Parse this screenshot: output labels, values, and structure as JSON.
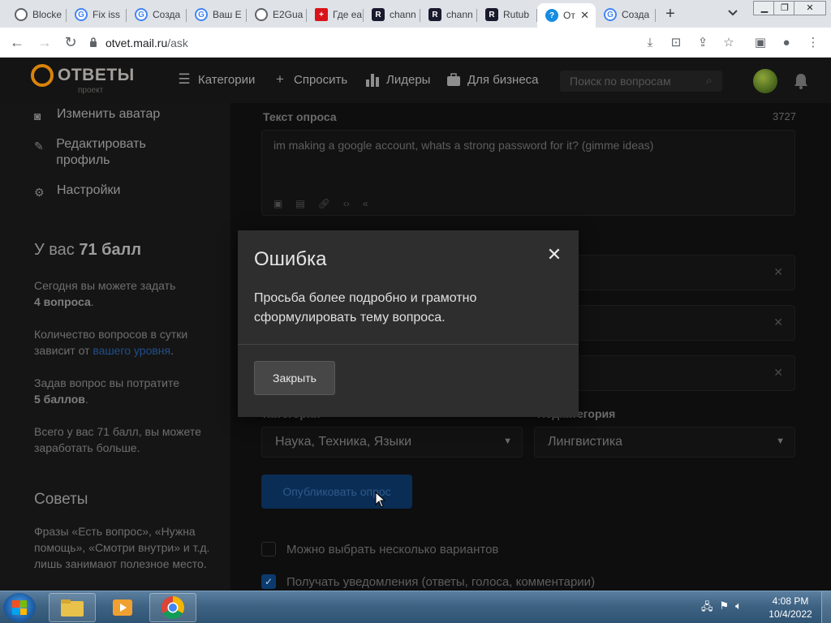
{
  "browser": {
    "tabs": [
      {
        "title": "Blocke",
        "fav": "globe",
        "color": "#5f6368"
      },
      {
        "title": "Fix iss",
        "fav": "G",
        "color": "#4285f4"
      },
      {
        "title": "Созда",
        "fav": "G",
        "color": "#4285f4"
      },
      {
        "title": "Ваш Е",
        "fav": "G",
        "color": "#4285f4"
      },
      {
        "title": "E2Gua",
        "fav": "globe",
        "color": "#5f6368"
      },
      {
        "title": "Где ea",
        "fav": "flag",
        "color": "#d8141a"
      },
      {
        "title": "chann",
        "fav": "R",
        "color": "#1a1a2e"
      },
      {
        "title": "chann",
        "fav": "R",
        "color": "#1a1a2e"
      },
      {
        "title": "Rutub",
        "fav": "R",
        "color": "#1a1a2e"
      },
      {
        "title": "От",
        "fav": "?",
        "color": "#168de2"
      },
      {
        "title": "Созда",
        "fav": "G",
        "color": "#4285f4"
      }
    ],
    "active_tab": 9,
    "url_host": "otvet.mail.ru",
    "url_path": "/ask",
    "window_buttons": [
      "minimize",
      "restore",
      "close"
    ]
  },
  "site": {
    "logo_name": "ОТВЕТЫ",
    "logo_sub": "проект",
    "nav": [
      {
        "label": "Категории",
        "icon": "list-icon"
      },
      {
        "label": "Спросить",
        "icon": "plus-icon"
      },
      {
        "label": "Лидеры",
        "icon": "chart-icon"
      },
      {
        "label": "Для бизнеса",
        "icon": "briefcase-icon"
      }
    ],
    "search_placeholder": "Поиск по вопросам"
  },
  "sidebar": {
    "menu": [
      {
        "label": "Изменить аватар",
        "icon": "camera-icon"
      },
      {
        "label": "Редактировать профиль",
        "icon": "pencil-icon"
      },
      {
        "label": "Настройки",
        "icon": "gear-icon"
      }
    ],
    "score_prefix": "У вас",
    "score_value": "71 балл",
    "p1_text": "Сегодня вы можете задать",
    "p1_bold": "4 вопроса",
    "p2_text": "Количество вопросов в сутки зависит от",
    "p2_link": "вашего уровня",
    "p3_text": "Задав вопрос вы потратите",
    "p3_bold": "5 баллов",
    "p4_text": "Всего у вас 71 балл, вы можете заработать больше.",
    "tips_title": "Советы",
    "tips_text": "Фразы «Есть вопрос», «Нужна помощь», «Смотри внутри» и т.д. лишь занимают полезное место."
  },
  "form": {
    "text_label": "Текст опроса",
    "counter": "3727",
    "text_value": "im making a google account, whats a strong password for it? (gimme ideas)",
    "category_label": "Категория",
    "category_value": "Наука, Техника, Языки",
    "subcategory_label": "Подкатегория",
    "subcategory_value": "Лингвистика",
    "publish_label": "Опубликовать опрос",
    "checkbox_multi": "Можно выбрать несколько вариантов",
    "checkbox_notify": "Получать уведомления (ответы, голоса, комментарии)"
  },
  "modal": {
    "title": "Ошибка",
    "message": "Просьба более подробно и грамотно сформулировать тему вопроса.",
    "close_button": "Закрыть"
  },
  "taskbar": {
    "time": "4:08 PM",
    "date": "10/4/2022"
  }
}
